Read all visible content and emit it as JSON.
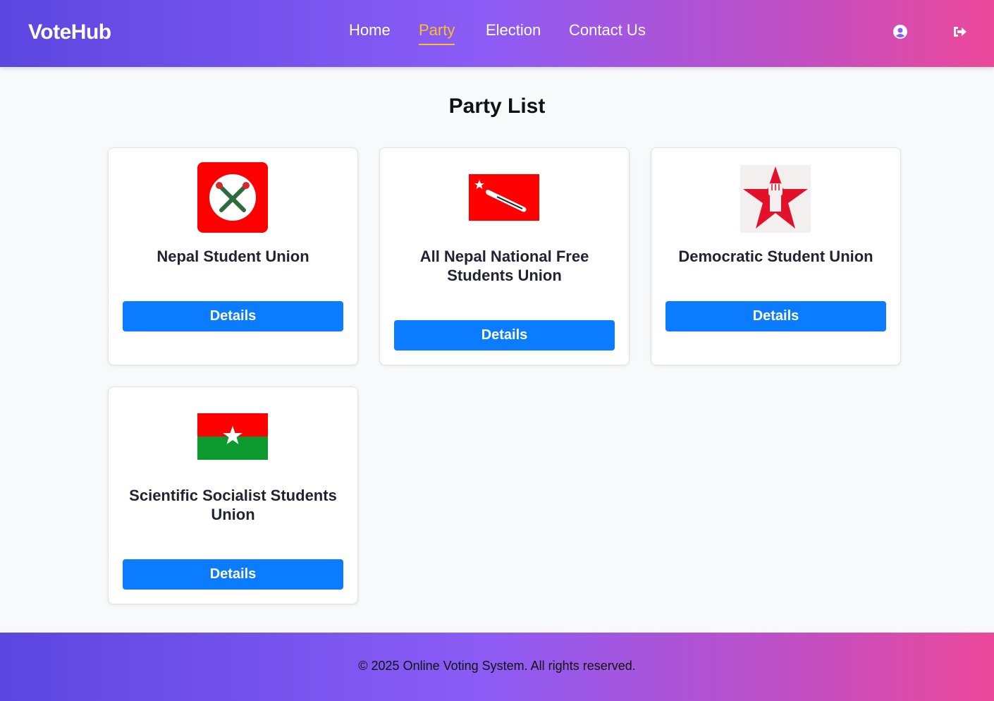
{
  "header": {
    "brand": "VoteHub",
    "nav": [
      {
        "label": "Home",
        "active": false
      },
      {
        "label": "Party",
        "active": true
      },
      {
        "label": "Election",
        "active": false
      },
      {
        "label": "Contact Us",
        "active": false
      }
    ],
    "icons": [
      "user-circle-icon",
      "sign-out-icon"
    ]
  },
  "main": {
    "title": "Party List",
    "parties": [
      {
        "name": "Nepal Student Union",
        "button": "Details",
        "logo": "crossed-torches-logo"
      },
      {
        "name": "All Nepal National Free Students Union",
        "button": "Details",
        "logo": "red-flag-pen-star-logo"
      },
      {
        "name": "Democratic Student Union",
        "button": "Details",
        "logo": "red-star-fist-logo"
      },
      {
        "name": "Scientific Socialist Students Union",
        "button": "Details",
        "logo": "red-green-star-flag-logo"
      }
    ]
  },
  "footer": {
    "text": "© 2025 Online Voting System. All rights reserved."
  },
  "colors": {
    "accent_active": "#fbbf24",
    "button": "#0b7bff",
    "gradient_start": "#5b47e0",
    "gradient_end": "#ec4899"
  }
}
